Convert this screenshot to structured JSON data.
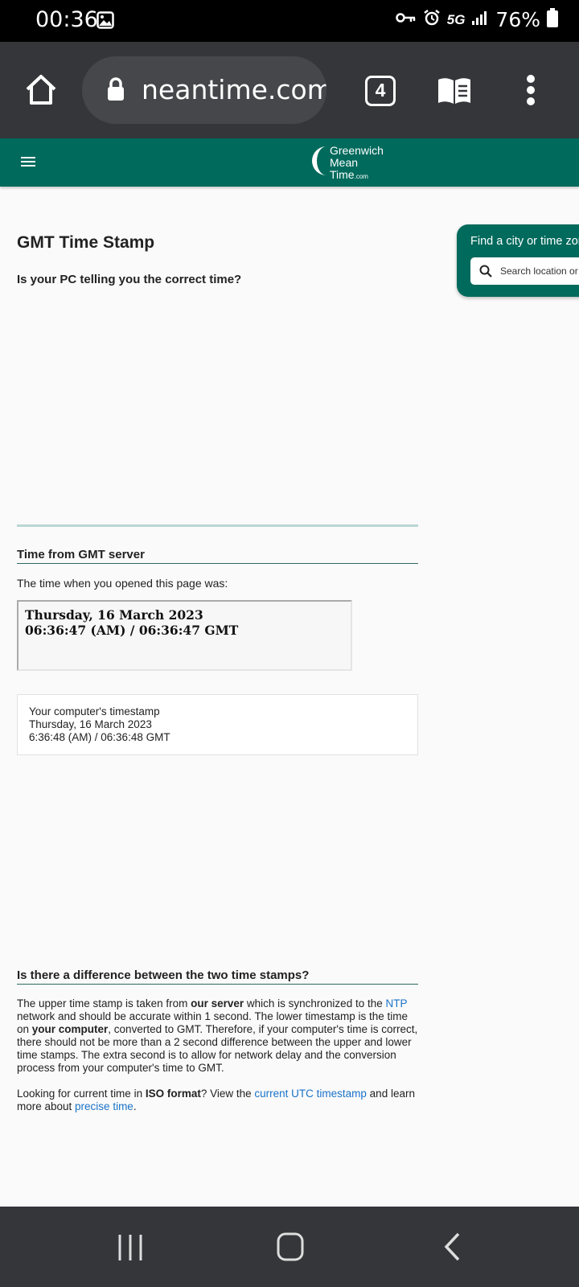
{
  "status_bar": {
    "time": "00:36",
    "network": "5G",
    "battery": "76%"
  },
  "browser": {
    "url_display": "neantime.com",
    "tab_count": "4"
  },
  "site": {
    "logo_lines": [
      "Greenwich",
      "Mean",
      "Time"
    ],
    "logo_suffix": ".com"
  },
  "page": {
    "title": "GMT Time Stamp",
    "question": "Is your PC telling you the correct time?",
    "server_section_heading": "Time from GMT server",
    "opened_text": "The time when you opened this page was:",
    "server_time": {
      "date": "Thursday, 16 March 2023",
      "time": "06:36:47 (AM) / 06:36:47 GMT"
    },
    "local_time": {
      "label": "Your computer's timestamp",
      "date": "Thursday, 16 March 2023",
      "time": "6:36:48 (AM) / 06:36:48 GMT"
    },
    "difference_heading": "Is there a difference between the two time stamps?",
    "para1": {
      "t1": "The upper time stamp is taken from ",
      "b1": "our server",
      "t2": " which is synchronized to the ",
      "link_ntp": "NTP",
      "t3": " network and should be accurate within 1 second. The lower timestamp is the time on ",
      "b2": "your computer",
      "t4": ", converted to GMT. Therefore, if your computer's time is correct, there should not be more than a 2 second difference between the upper and lower time stamps. The extra second is to allow for network delay and the conversion process from your computer's time to GMT."
    },
    "para2": {
      "t1": "Looking for current time in ",
      "b1": "ISO format",
      "t2": "? View the ",
      "link_utc": "current UTC timestamp",
      "t3": " and learn more about ",
      "link_precise": "precise time",
      "t4": "."
    }
  },
  "widget": {
    "title": "Find a city or time zone",
    "search_placeholder": "Search location or"
  },
  "colors": {
    "brand_green": "#006a5c",
    "link_blue": "#1a73c8",
    "toolbar_grey": "#35363a"
  }
}
